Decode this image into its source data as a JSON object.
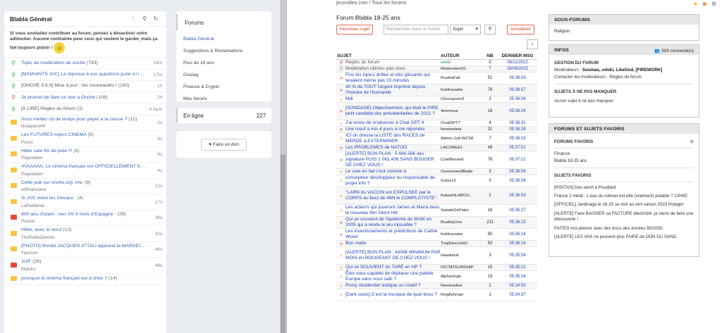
{
  "onche": {
    "main_title": "Blabla Général",
    "notice": "Si vous souhaitez contribuer au forum, pensez à désactiver votre adblocker. Aucune contrainte pour ceux qui veulent le garder, mais ça fait toujours plaisir !",
    "topics": [
      {
        "title": "Topic de modération de onche",
        "count": "(743)",
        "author": "",
        "time": "16m",
        "icon": "pin-green",
        "color": "blue"
      },
      {
        "title": "[MIGRANTS JVC] La réponse à vos questions juste ici !",
        "count": "(260)",
        "author": "",
        "time": "17m",
        "icon": "pin-green",
        "color": "blue"
      },
      {
        "title": "[ONCHE 3.6.0] Mise à jour : les nouveautés !",
        "count": "(190)",
        "author": "",
        "time": "1h",
        "icon": "pin-green",
        "color": "grey"
      },
      {
        "title": "Je promet de faire un don a Onche",
        "count": "(108)",
        "author": "",
        "time": "2h",
        "icon": "pin-red",
        "color": "blue"
      },
      {
        "title": "[À LIRE] Règles du forum",
        "count": "(3)",
        "author": "",
        "time": "4 mois",
        "icon": "pin-green",
        "color": "grey"
      },
      {
        "title": "Vous mettez cb de temps pour payer a la caisse ?",
        "count": "(12)",
        "author": "Nvaquero49",
        "time": "2s",
        "icon": "folder",
        "color": "blue"
      },
      {
        "title": "Les FUTURES topics CINEMA",
        "count": "(5)",
        "author": "Porno",
        "time": "4s",
        "icon": "folder",
        "color": "blue"
      },
      {
        "title": "Hitler sale fils de pute !!!",
        "count": "(0)",
        "author": "Playstation",
        "time": "4s",
        "icon": "folder",
        "color": "blue"
      },
      {
        "title": "AYAAAAA, Le cinéma français est OFFICIELLEMENT SAUVÉ",
        "count": "(12)",
        "author": "Playstation",
        "time": "4s",
        "icon": "folder",
        "color": "blue"
      },
      {
        "title": "Cette pub sur onche.org :rire:",
        "count": "(9)",
        "author": "sdfmaiscava",
        "time": "12s",
        "icon": "folder",
        "color": "blue"
      },
      {
        "title": "Si JVC retire les niveaux..",
        "count": "(4)",
        "author": "LaPaelleras",
        "time": "17s",
        "icon": "folder",
        "color": "blue"
      },
      {
        "title": "800 ans d'islam : rien VS 9 mois d'Espagne :",
        "count": "(29)",
        "author": "Putaso",
        "time": "39s",
        "icon": "folder-red",
        "color": "blue"
      },
      {
        "title": "Hitler, avec le recul",
        "count": "(13)",
        "author": "TheRadioDemon",
        "time": "40s",
        "icon": "folder",
        "color": "blue"
      },
      {
        "title": "[PHOTO] Bordel JACQUES ATTALI apprend la MARSEILLAISE aux MIGRA",
        "count": "(4)",
        "author": "Fascism",
        "time": "44s",
        "icon": "folder",
        "color": "blue"
      },
      {
        "title": "JUIF",
        "count": "(26)",
        "author": "Malotru",
        "time": "49s",
        "icon": "folder-red",
        "color": "blue"
      },
      {
        "title": "pourquoi le cinéma français est à chier ?",
        "count": "(14)",
        "author": "",
        "time": "",
        "icon": "folder",
        "color": "blue"
      }
    ],
    "forums_title": "Forums",
    "forums": [
      "Blabla Général",
      "Suggestions & Réclamations",
      "Plus de 18 ans",
      "Goulag",
      "Finance & Crypto",
      "Mes favoris"
    ],
    "online_label": "En ligne",
    "online_count": "227",
    "donate_label": "Faire un don"
  },
  "jvc": {
    "breadcrumb": "jeuxvideo.com / Tous les forums",
    "forum_title": "Forum Blabla 18-25 ans",
    "new_topic": "Nouveau sujet",
    "search_placeholder": "Rechercher dans le forum",
    "search_option": "Sujet",
    "refresh": "Actualiser",
    "headers": {
      "subject": "SUJET",
      "author": "AUTEUR",
      "nb": "NB",
      "last": "DERNIER MSG"
    },
    "rows": [
      {
        "s": "Règles du forum",
        "a": "odoki",
        "n": "0",
        "d": "08/11/2022",
        "i": "pin-r",
        "grey": true,
        "ac": "green",
        "h": 9
      },
      {
        "s": "Modération ultime» pas nous",
        "a": "Moderation51",
        "n": "7",
        "d": "28/09/2022",
        "i": "pin-g",
        "grey": true,
        "ac": "",
        "h": 9
      },
      {
        "s": "Fins les topics drôles et très glissants qui tenaient même pas 10 minutes.",
        "a": "RuskiaFail",
        "n": "51",
        "d": "05:38:59",
        "i": "ar-r",
        "ac": "",
        "h": 17
      },
      {
        "s": "40 % de TOUT l'argent imprimé depuis l'histoire de l'humanité",
        "a": "holdmysake",
        "n": "76",
        "d": "05:38:57",
        "i": "ar-r",
        "ac": "",
        "h": 17
      },
      {
        "s": "Mdr",
        "a": "Chocopoire3",
        "n": "2",
        "d": "05:38:36",
        "i": "ar-y",
        "ac": "",
        "h": 9
      },
      {
        "s": "[SONDAGE] Objectivement, qui était le PIRE petit candidat des présidentielles de 2022 ?",
        "a": "4emmour",
        "n": "18",
        "d": "05:38:34",
        "i": "ar-r",
        "ac": "",
        "h": 25
      },
      {
        "s": "J'ai envie de m'abonner à Chat GPT 4",
        "a": "ChatGPT7",
        "n": "4",
        "d": "05:38:31",
        "i": "ar-y",
        "ac": "",
        "h": 9
      },
      {
        "s": "Une meuf a mis 4 jours à me répondre",
        "a": "fenetredetir",
        "n": "31",
        "d": "05:38:28",
        "i": "ar-r",
        "ac": "",
        "h": 9
      },
      {
        "s": "ICI on dresse la LISTE des RACES de MERDE à EXTERMINER",
        "a": "Admin-Juif-WC58",
        "n": "7",
        "d": "05:38:15",
        "i": "ar-y",
        "ac": "",
        "h": 17
      },
      {
        "s": "Les PROBLEMES de NATOO",
        "a": "LACOREE1",
        "n": "49",
        "d": "05:37:51",
        "i": "ar-r",
        "ac": "",
        "h": 9
      },
      {
        "s": "[ALERTE] BON PLAN : 5 686,56€ des signature PUIS 1 061,42€ SANS BOUGER DE CHEZ VOUS !",
        "a": "CoieBennett",
        "n": "76",
        "d": "05:37:21",
        "i": "ar-r",
        "ac": "",
        "h": 25
      },
      {
        "s": "Le vote en fait c'est comme si",
        "a": "OverextandBlade",
        "n": "3",
        "d": "05:36:56",
        "i": "ar-y",
        "ac": "",
        "h": 9
      },
      {
        "s": "concepteur développeur ou responsable de projet info ?",
        "a": "Gutsx12",
        "n": "0",
        "d": "05:36:56",
        "i": "ar-y",
        "ac": "",
        "h": 17
      },
      {
        "s": "\"LARN du VACCIN est EXPULSEE par le CORPS au bout de 48H le COMPLOTISTE\"",
        "a": "KakashiLABOU..",
        "n": "2",
        "d": "05:36:53",
        "i": "ar-y",
        "ac": "",
        "h": 25
      },
      {
        "s": "Les acteurs qui joueront James et Maria dans le nouveau film Silent Hill",
        "a": "SaladeDeFlaks",
        "n": "16",
        "d": "05:36:27",
        "i": "ar-y",
        "ac": "",
        "h": 17
      },
      {
        "s": "Qui se souvient de l'épidémie de WoW en 2005 qui a rendu le jeu injouable ?",
        "a": "RuskiaUrss",
        "n": "211",
        "d": "05:36:22",
        "i": "ar-r",
        "ac": "",
        "h": 17
      },
      {
        "s": "Les investissements et prédictions de Cathie Wood",
        "a": "holdmysake",
        "n": "95",
        "d": "05:36:14",
        "i": "ar-r",
        "ac": "",
        "h": 17
      },
      {
        "s": "Bon matin",
        "a": "TrapDesuUwU",
        "n": "50",
        "d": "05:36:14",
        "i": "ar-r",
        "ac": "",
        "h": 9
      },
      {
        "s": "[ALERTE] BON PLAN : 4300€ MINIMUM PAR MOIS en BOUGEANT DE CHEZ VOUS !",
        "a": "Haaaland",
        "n": "3",
        "d": "05:35:54",
        "i": "ar-y",
        "ac": "",
        "h": 25
      },
      {
        "s": "Qui se SOUVIENT du TARÉ en HP ?",
        "a": "DICTATEURSHIP",
        "n": "15",
        "d": "05:35:21",
        "i": "ar-y",
        "ac": "",
        "h": 9
      },
      {
        "s": "Êtes vous capable de déplacer une palette Europe sans vous salir ?",
        "a": "Alphacinge",
        "n": "19",
        "d": "05:35:16",
        "i": "ar-y",
        "ac": "",
        "h": 17
      },
      {
        "s": "Proxy résidentiel statique ou rotatif ?",
        "a": "foreshadow",
        "n": "2",
        "d": "05:34:50",
        "i": "ar-y",
        "ac": "",
        "h": 9
      },
      {
        "s": "[Dark souls] C'est la musique de quel boss ?",
        "a": "Kingfishman",
        "n": "1",
        "d": "05:34:37",
        "i": "ar-y",
        "ac": "",
        "h": 17
      }
    ],
    "sous_forums": {
      "title": "SOUS-FORUMS",
      "item": "Religion"
    },
    "infos": {
      "title": "INFOS",
      "online": "303 connecté(s)",
      "gestion": "GESTION DU FORUM",
      "moderateurs_label": "Modérateurs :",
      "moderateurs": "Suumas, odoki, LikeGod, [FIREWORK]",
      "contact": "Contacter les modérateurs - Règles du forum",
      "manquer": "SUJETS À NE PAS MANQUER",
      "aucun": "Aucun sujet à ne pas manquer"
    },
    "favoris": {
      "title": "FORUMS ET SUJETS FAVORIS",
      "forums_label": "FORUMS FAVORIS",
      "forums": [
        "Finance",
        "Blabla 18-25 ans"
      ],
      "sujets_label": "SUJETS FAVORIS",
      "sujets": [
        "[RISITAS] Des wesh à Poudlard",
        "France 2 inédit : L'eau du robinet est-elle (vraiment) potable ? 23H00",
        "[OFFICIEL] Jardinage le 18-25 se met au vert saison 2023 Potager",
        "[ALERTE] Faire BAISSER sa FACTURE électricité, je viens de faire une découverte !",
        "FAITES moi pleurer avec des trucs des années 90/2000.",
        "[ALERTE] LES VAX ne peuvent plus FAIRE de DON DU SANG"
      ]
    }
  }
}
